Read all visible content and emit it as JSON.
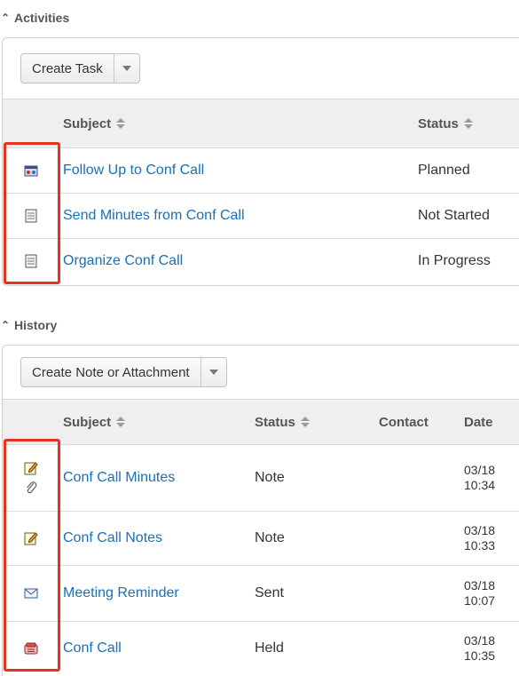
{
  "activities": {
    "title": "Activities",
    "create_button": "Create Task",
    "columns": {
      "subject": "Subject",
      "status": "Status"
    },
    "rows": [
      {
        "icon": "meeting-icon",
        "subject": "Follow Up to Conf Call",
        "status": "Planned"
      },
      {
        "icon": "task-icon",
        "subject": "Send Minutes from Conf Call",
        "status": "Not Started"
      },
      {
        "icon": "task-icon",
        "subject": "Organize Conf Call",
        "status": "In Progress"
      }
    ]
  },
  "history": {
    "title": "History",
    "create_button": "Create Note or Attachment",
    "columns": {
      "subject": "Subject",
      "status": "Status",
      "contact": "Contact",
      "date": "Date"
    },
    "rows": [
      {
        "icon": "note-icon",
        "attachment": true,
        "subject": "Conf Call Minutes",
        "status": "Note",
        "contact": "",
        "date": "03/18",
        "time": "10:34"
      },
      {
        "icon": "note-icon",
        "subject": "Conf Call Notes",
        "status": "Note",
        "contact": "",
        "date": "03/18",
        "time": "10:33"
      },
      {
        "icon": "email-icon",
        "subject": "Meeting Reminder",
        "status": "Sent",
        "contact": "",
        "date": "03/18",
        "time": "10:07"
      },
      {
        "icon": "call-icon",
        "subject": "Conf Call",
        "status": "Held",
        "contact": "",
        "date": "03/18",
        "time": "10:35"
      }
    ]
  },
  "colors": {
    "link": "#1a6fb5",
    "highlight": "#e8321e",
    "header_bg": "#efefef"
  }
}
